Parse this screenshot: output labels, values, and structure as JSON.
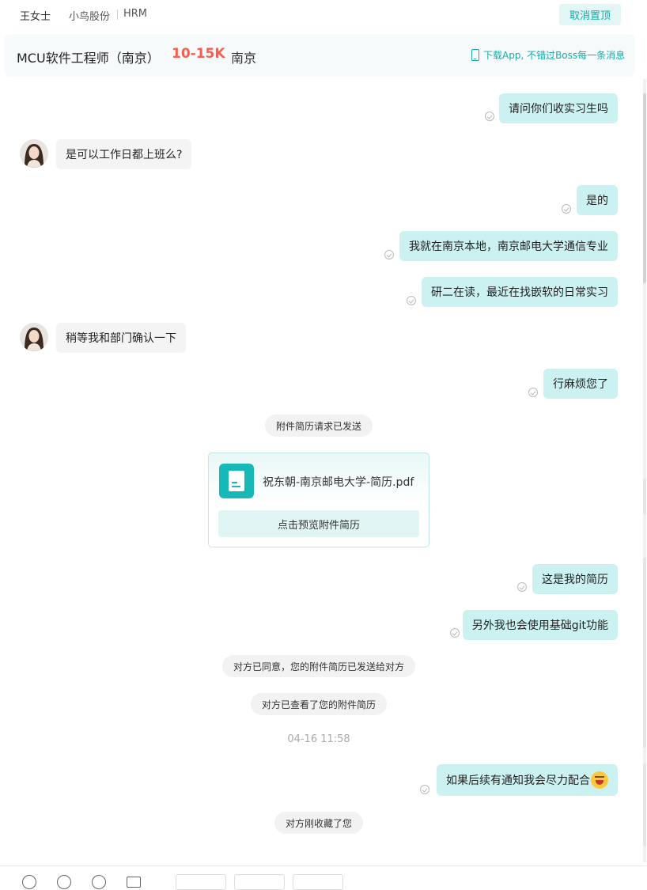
{
  "header": {
    "name": "王女士",
    "company": "小鸟股份",
    "role": "HRM",
    "unpin_label": "取消置顶"
  },
  "job": {
    "title": "MCU软件工程师（南京）",
    "salary": "10-15K",
    "city": "南京",
    "app_promo": "下载App, 不错过Boss每一条消息"
  },
  "messages": {
    "m1": "请问你们收实习生吗",
    "m2": "是可以工作日都上班么?",
    "m3": "是的",
    "m4": "我就在南京本地，南京邮电大学通信专业",
    "m5": "研二在读，最近在找嵌软的日常实习",
    "m6": "稍等我和部门确认一下",
    "m7": "行麻烦您了",
    "m8": "附件简历请求已发送",
    "m9": "这是我的简历",
    "m10": "另外我也会使用基础git功能",
    "m11": "对方已同意，您的附件简历已发送给对方",
    "m12": "对方已查看了您的附件简历",
    "m13": "04-16 11:58",
    "m14": "如果后续有通知我会尽力配合",
    "m15": "对方刚收藏了您"
  },
  "resume_card": {
    "file_name": "祝东朝-南京邮电大学-简历.pdf",
    "preview_label": "点击预览附件简历"
  },
  "icons": {
    "read_check": "check-circle-icon",
    "phone": "phone-icon",
    "file": "document-icon",
    "emoji": "grinning-face-emoji"
  },
  "colors": {
    "accent": "#18a9a9",
    "salary": "#ff5c4d",
    "outgoing_bubble": "#ccf1f1",
    "incoming_bubble": "#f4f4f4"
  }
}
